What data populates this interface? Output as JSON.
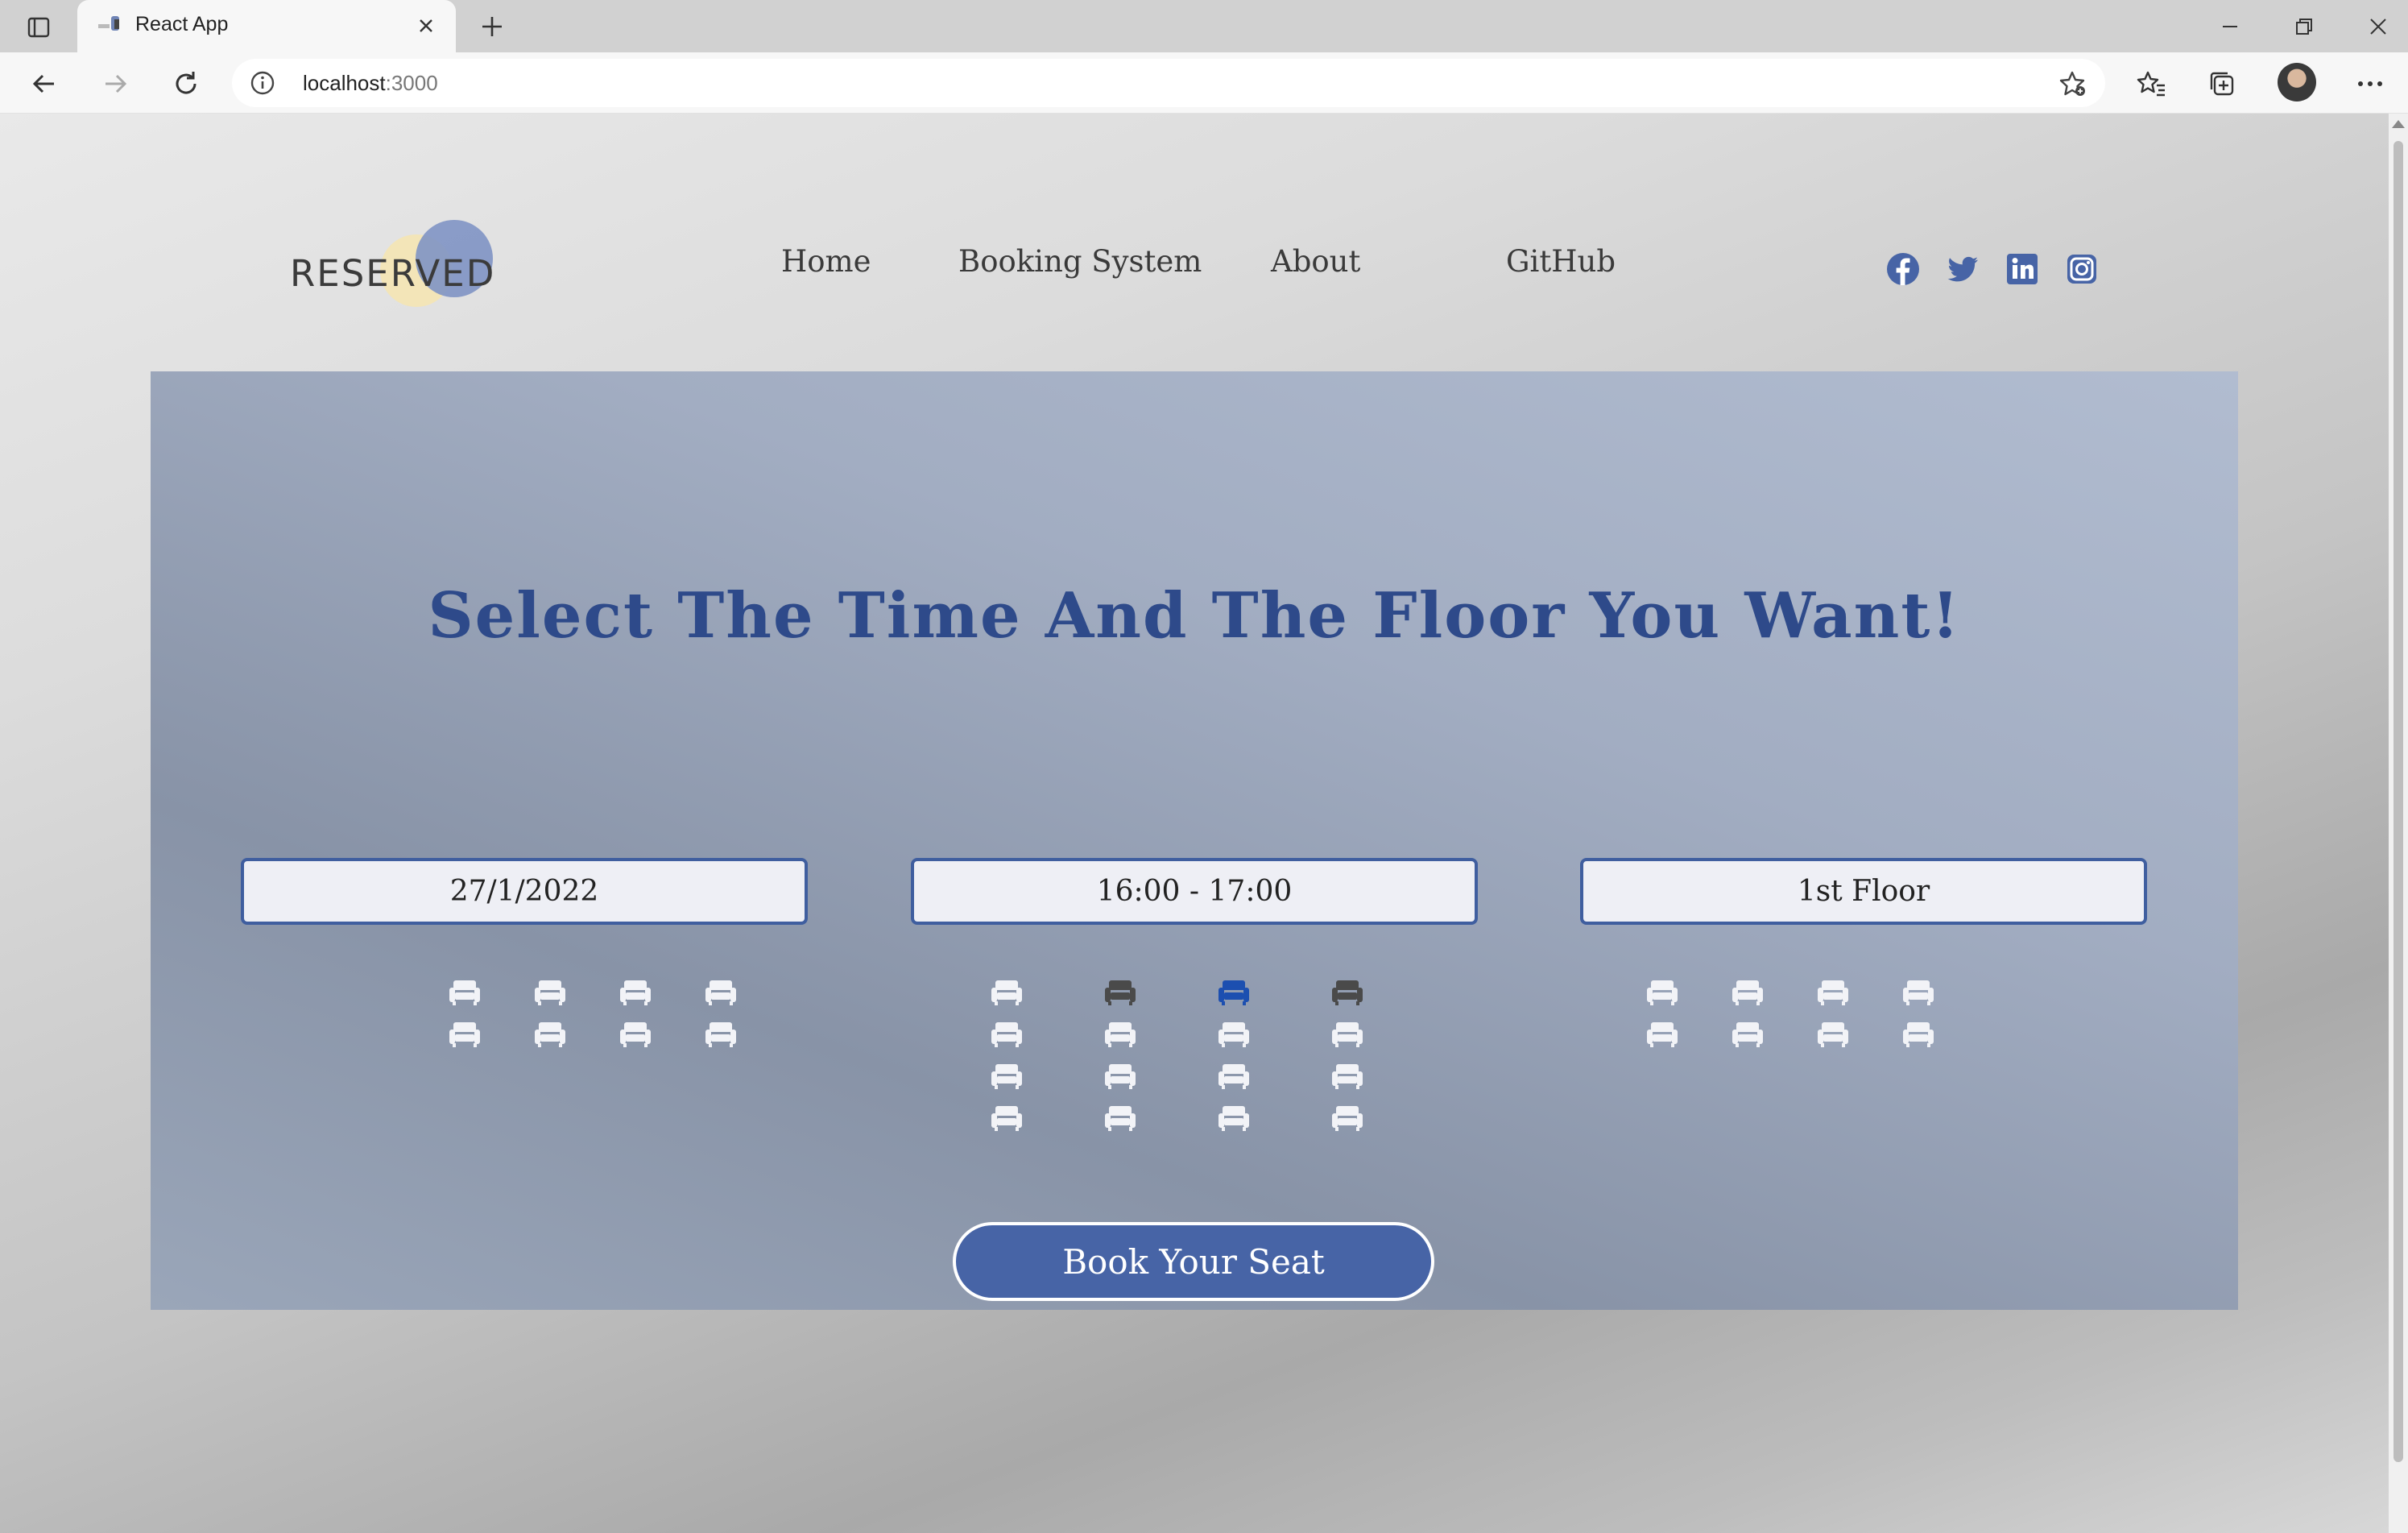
{
  "browser": {
    "tab_title": "React App",
    "url_host": "localhost",
    "url_port": ":3000"
  },
  "site": {
    "logo_text": "RESERVED",
    "nav": [
      "Home",
      "Booking System",
      "About",
      "GitHub"
    ],
    "social": [
      "facebook-icon",
      "twitter-icon",
      "linkedin-icon",
      "instagram-icon"
    ]
  },
  "booking": {
    "heading": "Select The Time And The Floor You Want!",
    "date": "27/1/2022",
    "time": "16:00 - 17:00",
    "floor": "1st Floor",
    "book_button": "Book Your Seat"
  },
  "seat_maps": {
    "left": {
      "rows": 2,
      "cols": 4,
      "states": [
        [
          "available",
          "available",
          "available",
          "available"
        ],
        [
          "available",
          "available",
          "available",
          "available"
        ]
      ]
    },
    "center": {
      "rows": 4,
      "cols": 4,
      "states": [
        [
          "available",
          "booked",
          "selected",
          "booked"
        ],
        [
          "available",
          "available",
          "available",
          "available"
        ],
        [
          "available",
          "available",
          "available",
          "available"
        ],
        [
          "available",
          "available",
          "available",
          "available"
        ]
      ]
    },
    "right": {
      "rows": 2,
      "cols": 4,
      "states": [
        [
          "available",
          "available",
          "available",
          "available"
        ],
        [
          "available",
          "available",
          "available",
          "available"
        ]
      ]
    }
  },
  "colors": {
    "seat_available": "#f2f3f7",
    "seat_booked": "#4a4a4a",
    "seat_selected": "#1c4fb0",
    "accent": "#4764a6",
    "heading": "#2e4a8a",
    "social": "#4764a6"
  }
}
